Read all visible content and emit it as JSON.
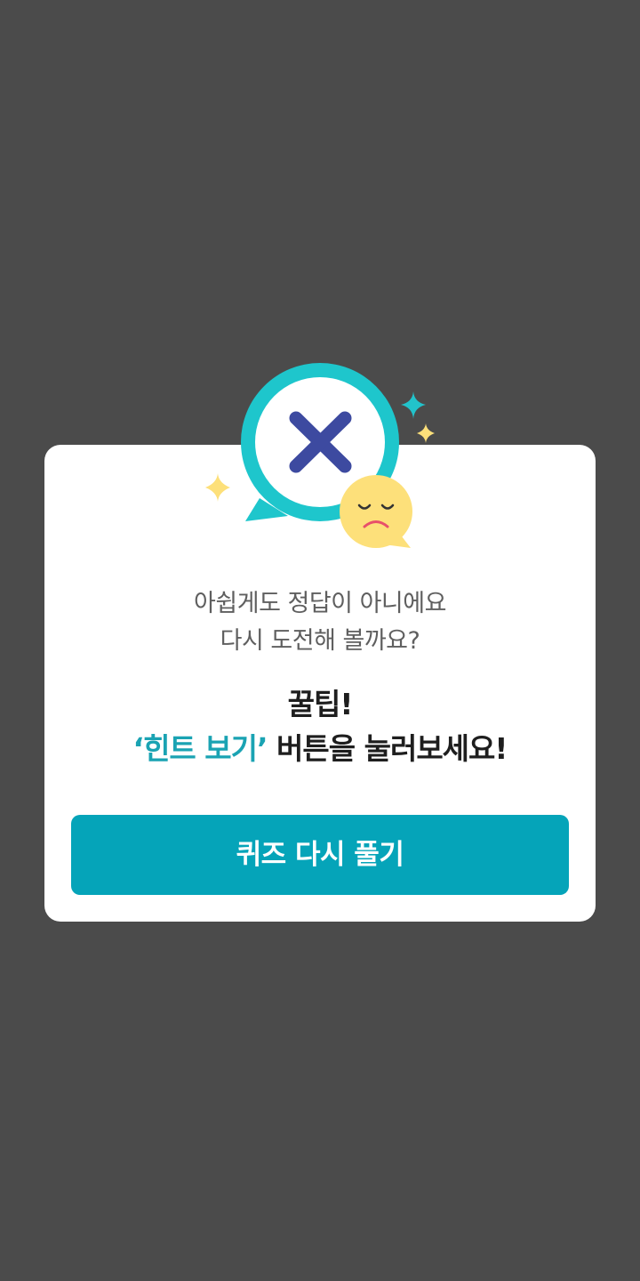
{
  "dialog": {
    "message_line1": "아쉽게도 정답이 아니에요",
    "message_line2": "다시 도전해 볼까요?",
    "tip_title": "꿀팁!",
    "tip_highlight": "‘힌트 보기’",
    "tip_rest": " 버튼을 눌러보세요!",
    "retry_button_label": "퀴즈 다시 풀기"
  },
  "illustration": {
    "icons": [
      "wrong-answer-bubble-icon",
      "x-mark-icon",
      "sad-face-icon",
      "sparkle-icon"
    ],
    "colors": {
      "bubble": "#1ec6cc",
      "x_mark": "#3d4aa0",
      "face": "#fde07a",
      "sparkle_teal": "#22c3cb",
      "sparkle_yellow": "#fde07a",
      "mouth": "#e8506a"
    }
  },
  "colors": {
    "backdrop": "#4b4b4b",
    "dialog_bg": "#ffffff",
    "accent": "#05a4b9",
    "highlight_text": "#1aa3b3"
  }
}
